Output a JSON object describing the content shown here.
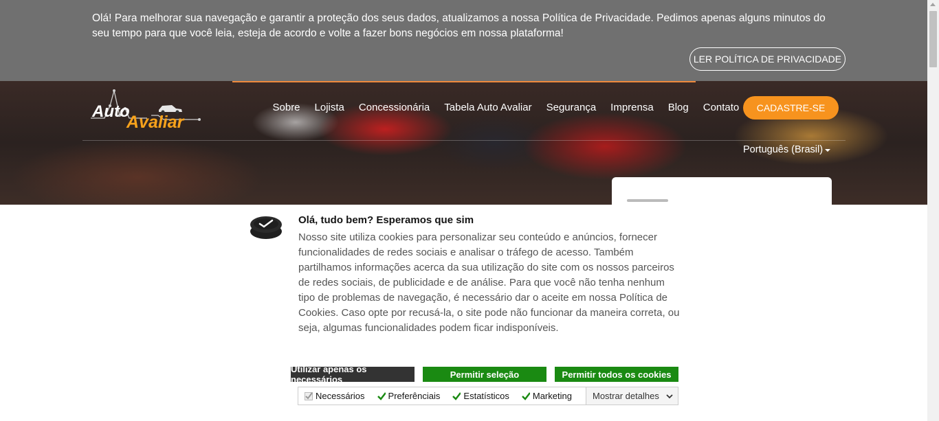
{
  "privacy_banner": {
    "text": "Olá! Para melhorar sua navegação e garantir a proteção dos seus dados, atualizamos a nossa Política de Privacidade. Pedimos apenas alguns minutos do seu tempo para que você leia, esteja de acordo e volte a fazer bons negócios em nossa plataforma!",
    "button_label": "LER POLÍTICA DE PRIVACIDADE"
  },
  "header": {
    "logo_text_1": "Auto",
    "logo_text_2": "Avaliar",
    "nav": [
      "Sobre",
      "Lojista",
      "Concessionária",
      "Tabela Auto Avaliar",
      "Segurança",
      "Imprensa",
      "Blog",
      "Contato"
    ],
    "signup_label": "CADASTRE-SE",
    "language": "Português (Brasil)"
  },
  "cookie_dialog": {
    "title": "Olá, tudo bem? Esperamos que sim",
    "body": "Nosso site utiliza cookies para personalizar seu conteúdo e anúncios, fornecer funcionalidades de redes sociais e analisar o tráfego de acesso. Também partilhamos informações acerca da sua utilização do site com os nossos parceiros de redes sociais, de publicidade e de análise. Para que você não tenha nenhum tipo de problemas de navegação, é necessário dar o aceite em nossa Política de Cookies. Caso opte por recusá-la, o site pode não funcionar da maneira correta, ou seja, algumas funcionalidades podem ficar indisponíveis.",
    "btn_necessary": "Utilizar apenas os necessários",
    "btn_selection": "Permitir seleção",
    "btn_all": "Permitir todos os cookies",
    "checkboxes": [
      {
        "label": "Necessários",
        "checked": true,
        "disabled": true
      },
      {
        "label": "Preferênciais",
        "checked": true,
        "disabled": false
      },
      {
        "label": "Estatísticos",
        "checked": true,
        "disabled": false
      },
      {
        "label": "Marketing",
        "checked": true,
        "disabled": false
      }
    ],
    "details_label": "Mostrar detalhes"
  },
  "colors": {
    "banner_bg": "#707070",
    "accent_orange": "#f7931e",
    "green": "#1a8a12",
    "dark_button": "#333333"
  }
}
